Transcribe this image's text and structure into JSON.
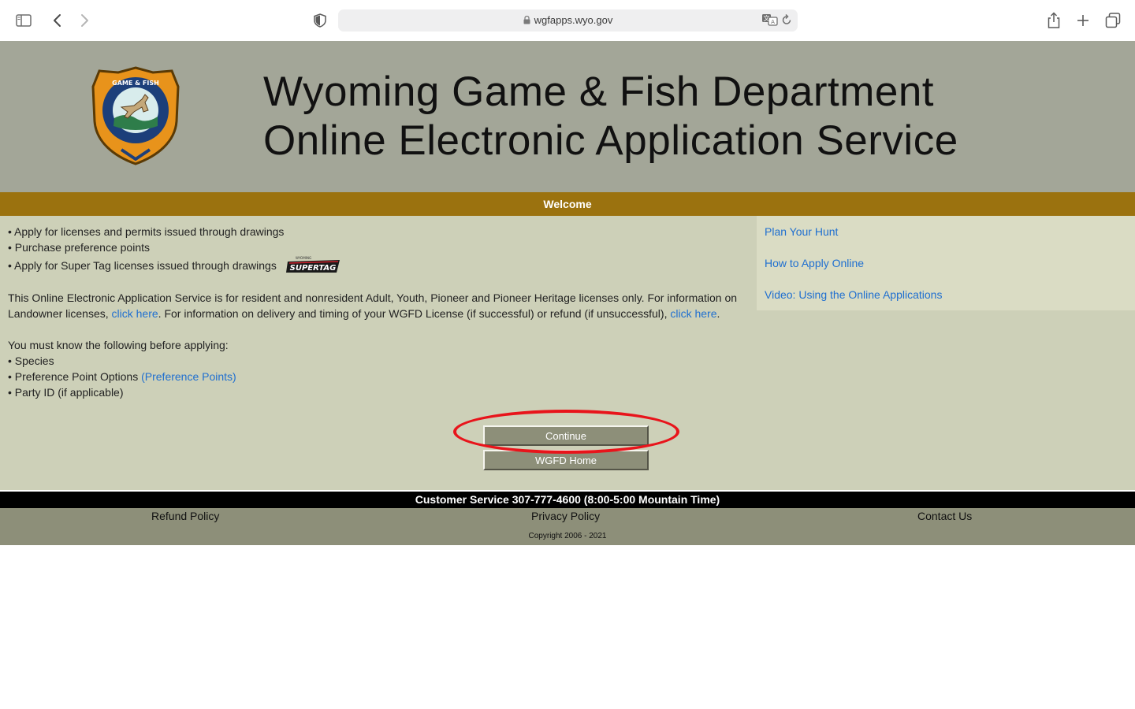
{
  "browser": {
    "url": "wgfapps.wyo.gov",
    "icons": [
      "sidebar-icon",
      "back-icon",
      "forward-icon",
      "privacy-shield-icon",
      "lock-icon",
      "translate-icon",
      "reload-icon",
      "share-icon",
      "new-tab-icon",
      "tab-overview-icon"
    ]
  },
  "banner": {
    "title_line1": "Wyoming Game & Fish Department",
    "title_line2": "Online Electronic Application Service",
    "logo": {
      "name": "wgfd-badge-logo",
      "seal_text": "WYOMING GAME & FISH DEPARTMENT"
    }
  },
  "welcome": "Welcome",
  "intro_bullets": [
    "• Apply for licenses and permits issued through drawings",
    "• Purchase preference points",
    "• Apply for Super Tag licenses issued through drawings"
  ],
  "supertag_logo": {
    "text": "SUPERTAG",
    "small_text": "WYOMING"
  },
  "description": {
    "part1": "This Online Electronic Application Service is for resident and nonresident Adult, Youth, Pioneer and Pioneer Heritage licenses only. For information on Landowner licenses, ",
    "link1": "click here",
    "part2": ". For information on delivery and timing of your WGFD License (if successful) or refund (if unsuccessful), ",
    "link2": "click here",
    "part3": "."
  },
  "requirements": {
    "heading": "You must know the following before applying:",
    "item1": "• Species",
    "item2": "• Preference Point Options ",
    "item2_link": "(Preference Points)",
    "item3": "• Party ID (if applicable)"
  },
  "sidebar_links": [
    "Plan Your Hunt",
    "How to Apply Online",
    "Video: Using the Online Applications"
  ],
  "buttons": {
    "continue": "Continue",
    "home": "WGFD Home"
  },
  "annotation_color": "#e8141b",
  "customer_service": "Customer Service 307-777-4600 (8:00-5:00 Mountain Time)",
  "footer": {
    "refund": "Refund Policy",
    "privacy": "Privacy Policy",
    "contact": "Contact Us",
    "copyright": "Copyright 2006 - 2021"
  }
}
